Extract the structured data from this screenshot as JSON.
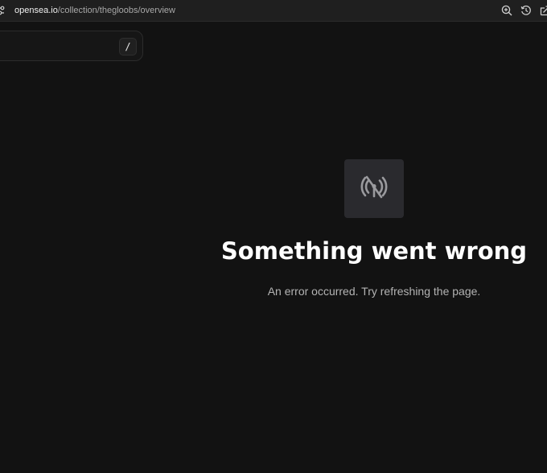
{
  "browser": {
    "url_domain": "opensea.io",
    "url_path": "/collection/thegloobs/overview",
    "icons": [
      "site-settings-icon",
      "zoom-icon",
      "history-icon",
      "share-icon"
    ]
  },
  "search": {
    "shortcut_key": "/"
  },
  "error": {
    "icon": "signal-off-icon",
    "title": "Something went wrong",
    "message": "An error occurred. Try refreshing the page."
  },
  "colors": {
    "background": "#121212",
    "icon_box": "#2a2a2e",
    "title": "#ffffff",
    "message": "#b3b3b3"
  }
}
